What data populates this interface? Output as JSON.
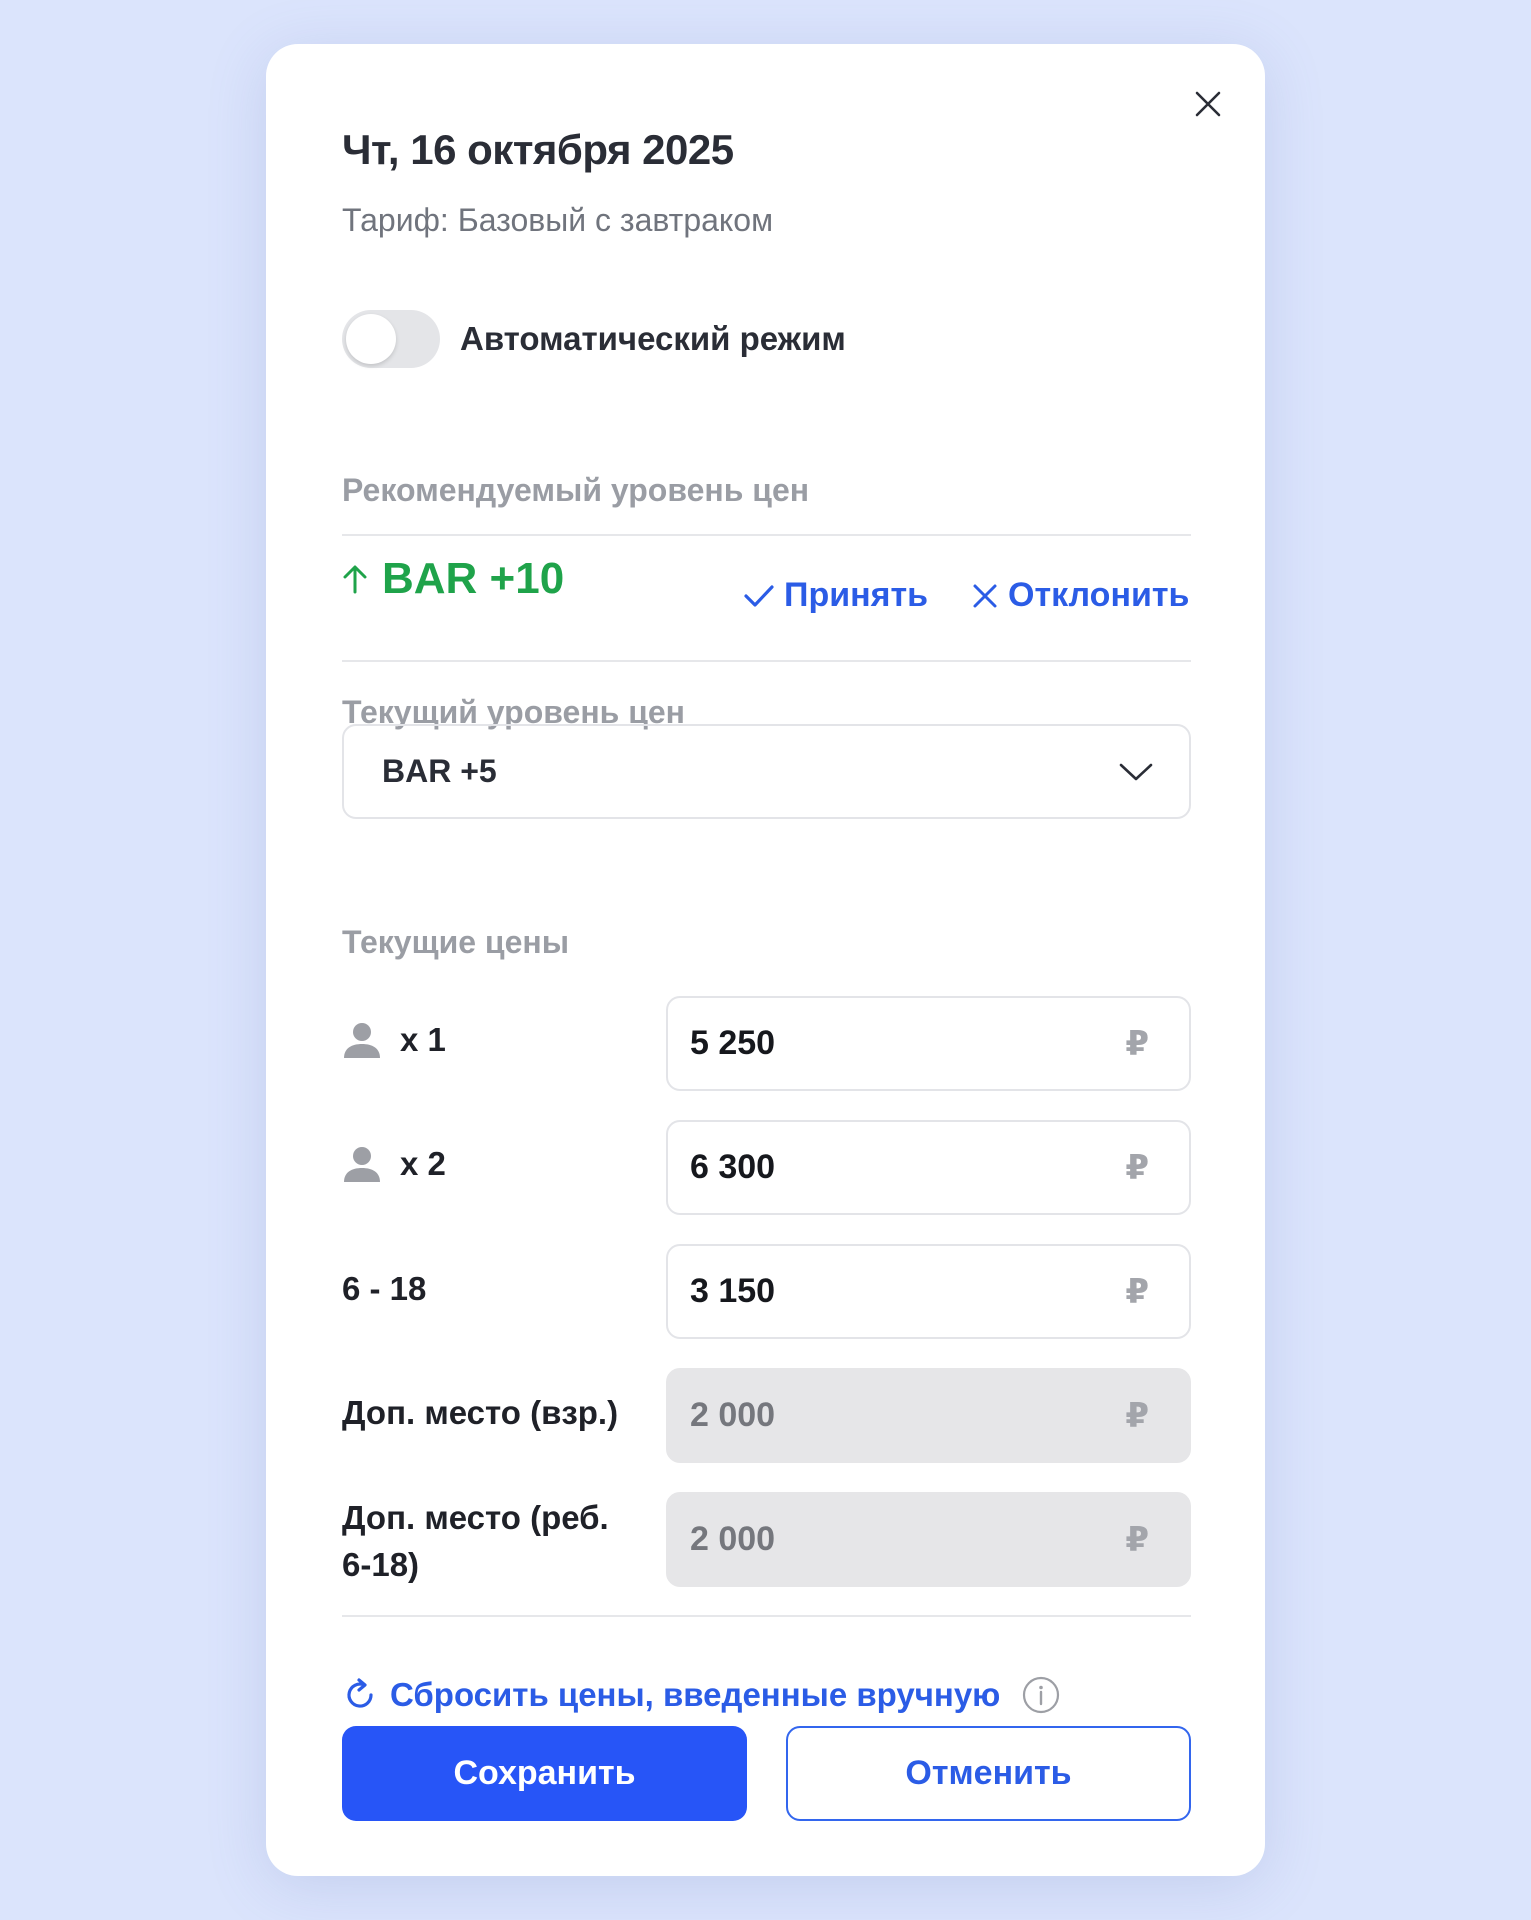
{
  "modal": {
    "title": "Чт, 16 октября 2025",
    "subtitle": "Тариф: Базовый с завтраком",
    "close_icon": "close-icon"
  },
  "auto_mode": {
    "label": "Автоматический режим",
    "enabled": false
  },
  "recommended": {
    "section_label": "Рекомендуемый уровень цен",
    "value": "BAR +10",
    "trend_icon": "arrow-up-icon",
    "accept_label": "Принять",
    "reject_label": "Отклонить"
  },
  "current_level": {
    "section_label": "Текущий уровень цен",
    "selected": "BAR +5"
  },
  "current_prices": {
    "section_label": "Текущие цены",
    "currency_symbol": "₽",
    "rows": [
      {
        "label": "x 1",
        "icon": "person-icon",
        "value": "5 250",
        "disabled": false
      },
      {
        "label": "x 2",
        "icon": "person-icon",
        "value": "6 300",
        "disabled": false
      },
      {
        "label": "6 - 18",
        "value": "3 150",
        "disabled": false
      },
      {
        "label": "Доп. место (взр.)",
        "value": "2 000",
        "disabled": true
      },
      {
        "label_line1": "Доп. место (реб.",
        "label_line2": "6-18)",
        "value": "2 000",
        "disabled": true
      }
    ]
  },
  "reset": {
    "label": "Сбросить цены, введенные вручную"
  },
  "buttons": {
    "save": "Сохранить",
    "cancel": "Отменить"
  },
  "colors": {
    "background": "#dbe4fc",
    "accent": "#2755f7",
    "link": "#2b5ce6",
    "positive": "#1fa34a"
  }
}
